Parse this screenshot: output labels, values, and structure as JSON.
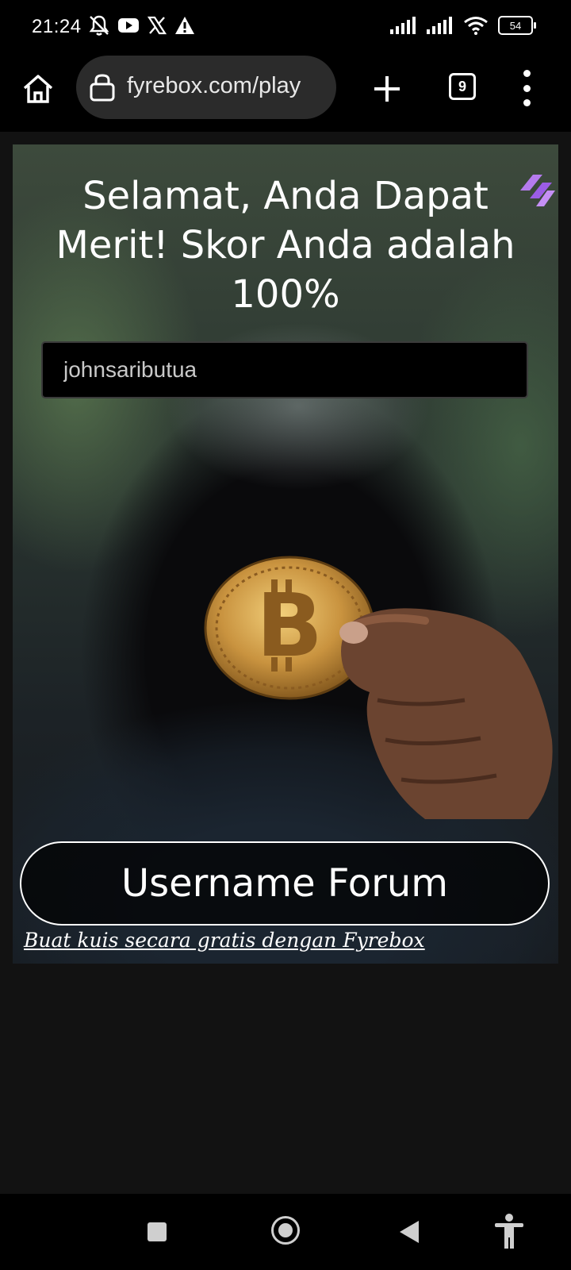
{
  "status_bar": {
    "time": "21:24",
    "battery": "54",
    "icons_left": [
      "mute-icon",
      "youtube-icon",
      "x-icon",
      "warning-icon"
    ],
    "icons_right": [
      "signal-icon",
      "signal-icon",
      "wifi-icon",
      "battery-icon"
    ]
  },
  "browser": {
    "url": "fyrebox.com/play",
    "tab_count": "9",
    "icons": [
      "home-icon",
      "lock-icon",
      "plus-icon",
      "tabs-icon",
      "menu-icon"
    ]
  },
  "quiz": {
    "title": "Selamat, Anda Dapat Merit! Skor Anda adalah 100%",
    "name_placeholder": "johnsaributua",
    "submit_label": "Username Forum",
    "footer_link": "Buat kuis secara gratis dengan Fyrebox",
    "accent_color": "#9b5de5"
  },
  "nav_bar": {
    "icons": [
      "recents-icon",
      "home-icon",
      "back-icon",
      "accessibility-icon"
    ]
  }
}
